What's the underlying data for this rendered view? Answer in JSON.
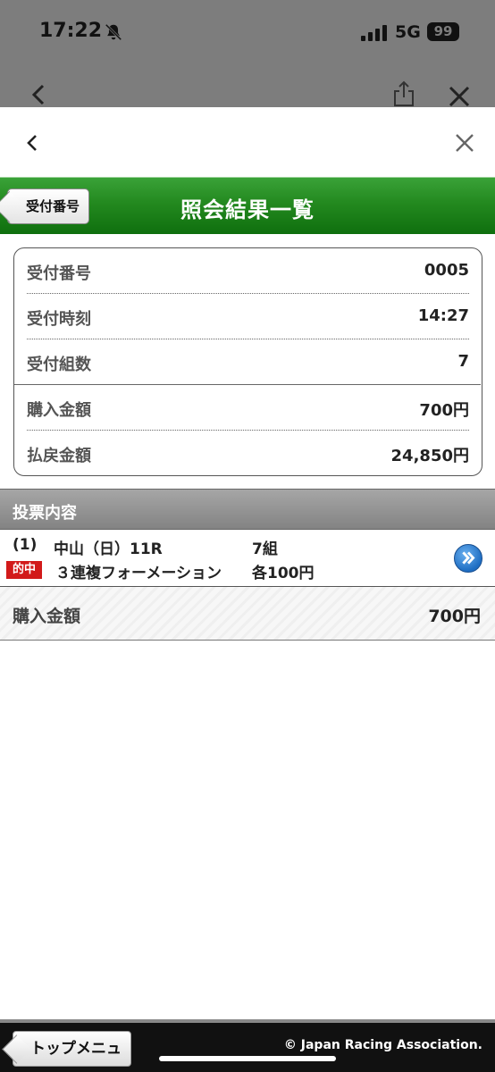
{
  "status_bar": {
    "time": "17:22",
    "network": "5G",
    "battery": "99",
    "icons": [
      "bell-slash-icon",
      "signal-bars-icon"
    ]
  },
  "browser_toolbar": {
    "icons": [
      "chevron-left-icon",
      "share-icon",
      "close-icon"
    ]
  },
  "sheet_nav": {
    "icons": [
      "chevron-left-icon",
      "close-icon"
    ]
  },
  "header": {
    "back_label": "受付番号",
    "title": "照会結果一覧",
    "color": "#23891f"
  },
  "info": {
    "rows": [
      {
        "label": "受付番号",
        "value": "0005"
      },
      {
        "label": "受付時刻",
        "value": "14:27"
      },
      {
        "label": "受付組数",
        "value": "7"
      },
      {
        "label": "購入金額",
        "value": "700円"
      },
      {
        "label": "払戻金額",
        "value": "24,850円"
      }
    ]
  },
  "section": {
    "title": "投票内容"
  },
  "bet": {
    "number": "(1)",
    "race": "中山（日）11R",
    "count": "7組",
    "badge": "的中",
    "badge_color": "#d21a1a",
    "type": "３連複フォーメーション",
    "unit": "各100円",
    "icon": "chevron-right-circle-icon"
  },
  "total": {
    "label": "購入金額",
    "value": "700円"
  },
  "footer": {
    "menu_label": "トップメニュー",
    "copyright": "© Japan Racing Association."
  }
}
